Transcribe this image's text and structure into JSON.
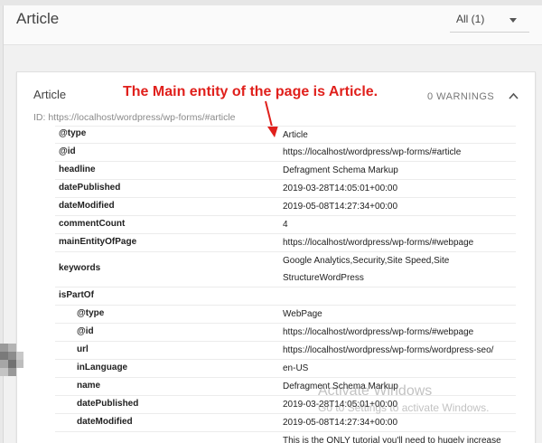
{
  "header": {
    "title": "Article",
    "filter_label": "All (1)"
  },
  "card": {
    "title": "Article",
    "warnings": "0 WARNINGS",
    "id_line": "ID: https://localhost/wordpress/wp-forms/#article"
  },
  "annotation": "The Main entity of the page is Article.",
  "rows": [
    {
      "key": "@type",
      "value": "Article"
    },
    {
      "key": "@id",
      "value": "https://localhost/wordpress/wp-forms/#article"
    },
    {
      "key": "headline",
      "value": "Defragment Schema Markup"
    },
    {
      "key": "datePublished",
      "value": "2019-03-28T14:05:01+00:00"
    },
    {
      "key": "dateModified",
      "value": "2019-05-08T14:27:34+00:00"
    },
    {
      "key": "commentCount",
      "value": "4"
    },
    {
      "key": "mainEntityOfPage",
      "value": "https://localhost/wordpress/wp-forms/#webpage"
    },
    {
      "key": "keywords",
      "value": "Google Analytics,Security,Site Speed,Site StructureWordPress"
    },
    {
      "key": "isPartOf",
      "value": ""
    },
    {
      "key": "@type",
      "value": "WebPage"
    },
    {
      "key": "@id",
      "value": "https://localhost/wordpress/wp-forms/#webpage"
    },
    {
      "key": "url",
      "value": "https://localhost/wordpress/wp-forms/wordpress-seo/"
    },
    {
      "key": "inLanguage",
      "value": "en-US"
    },
    {
      "key": "name",
      "value": "Defragment Schema Markup"
    },
    {
      "key": "datePublished",
      "value": "2019-03-28T14:05:01+00:00"
    },
    {
      "key": "dateModified",
      "value": "2019-05-08T14:27:34+00:00"
    },
    {
      "key": "",
      "value": "This is the ONLY tutorial you'll need to hugely increase"
    }
  ],
  "watermark": {
    "line1": "Activate Windows",
    "line2": "Go to Settings to activate Windows."
  },
  "colors": {
    "annotation": "#e0201c",
    "page_bg": "#f1f1f1",
    "card_bg": "#ffffff"
  },
  "icons": [
    "chevron-up-icon",
    "chevron-down-icon",
    "annotation-arrow-icon",
    "blurred-icon"
  ]
}
